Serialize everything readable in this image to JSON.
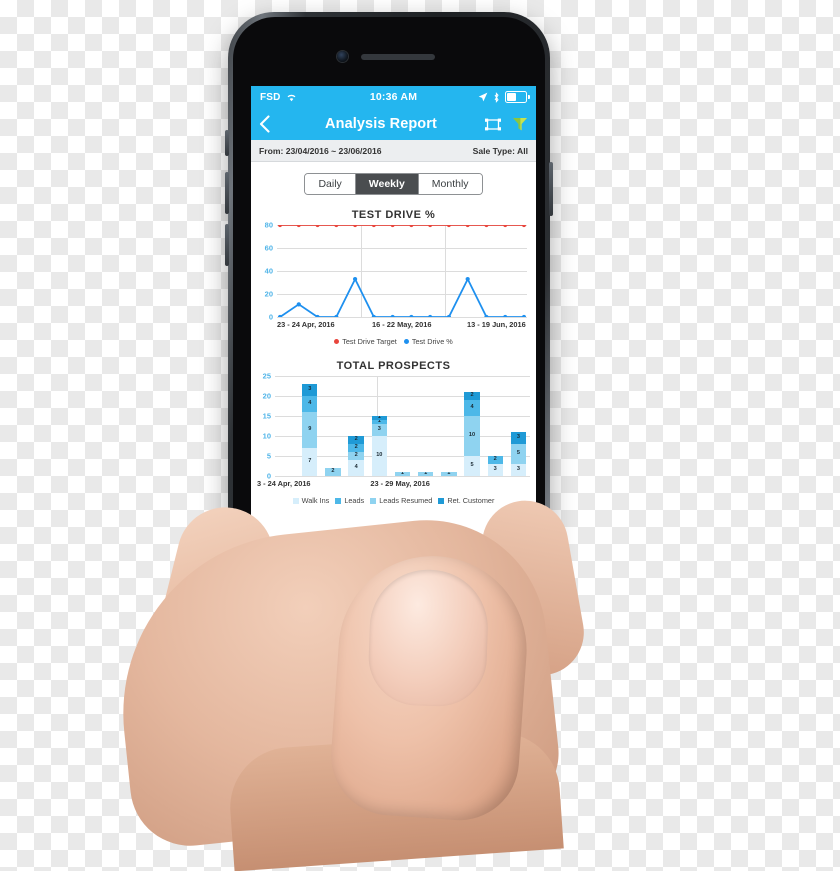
{
  "device": {
    "frame_color": "#2b2e32",
    "screen_bg": "#ffffff"
  },
  "status_bar": {
    "carrier": "FSD",
    "wifi_icon": "wifi-icon",
    "time": "10:36 AM",
    "location_icon": "location-arrow-icon",
    "bluetooth_icon": "bluetooth-icon",
    "battery_icon": "battery-icon",
    "accent": "#24b6ef"
  },
  "nav_bar": {
    "back_icon": "chevron-left-icon",
    "title": "Analysis Report",
    "fullscreen_icon": "fullscreen-icon",
    "filter_icon": "filter-funnel-icon",
    "filter_icon_color": "#8cc63f"
  },
  "filter_bar": {
    "date_range": "From: 23/04/2016 ~ 23/06/2016",
    "sale_type": "Sale Type: All"
  },
  "segmented": {
    "options": [
      {
        "label": "Daily",
        "active": false
      },
      {
        "label": "Weekly",
        "active": true
      },
      {
        "label": "Monthly",
        "active": false
      }
    ]
  },
  "chart_data": [
    {
      "type": "line",
      "title": "TEST DRIVE %",
      "xlabel": "",
      "ylabel": "",
      "ylim": [
        0,
        80
      ],
      "yticks": [
        0,
        20,
        40,
        60,
        80
      ],
      "grid": true,
      "legend_position": "bottom",
      "x_tick_labels": [
        "23 - 24 Apr, 2016",
        "16 - 22 May, 2016",
        "13 - 19 Jun, 2016"
      ],
      "series": [
        {
          "name": "Test Drive Target",
          "color": "#e8453c",
          "values": [
            80,
            80,
            80,
            80,
            80,
            80,
            80,
            80,
            80,
            80,
            80,
            80,
            80,
            80
          ]
        },
        {
          "name": "Test Drive %",
          "color": "#1e90ef",
          "values": [
            0,
            11,
            0,
            0,
            33,
            0,
            0,
            0,
            0,
            0,
            33,
            0,
            0,
            0
          ]
        }
      ]
    },
    {
      "type": "bar",
      "subtype": "stacked",
      "title": "TOTAL PROSPECTS",
      "xlabel": "",
      "ylabel": "",
      "ylim": [
        0,
        25
      ],
      "yticks": [
        0,
        5,
        10,
        15,
        20,
        25
      ],
      "grid": true,
      "legend_position": "bottom",
      "x_tick_labels": [
        "3 - 24 Apr, 2016",
        "23 - 29 May, 2016"
      ],
      "series": [
        {
          "name": "Walk Ins",
          "color": "#d6eefb"
        },
        {
          "name": "Leads",
          "color": "#4db8e8"
        },
        {
          "name": "Leads Resumed",
          "color": "#8fd3f0"
        },
        {
          "name": "Ret. Customer",
          "color": "#1f9ad6"
        }
      ],
      "bars": [
        {
          "index": 0,
          "total": 0,
          "segments": []
        },
        {
          "index": 1,
          "total": 23,
          "segments": [
            {
              "series": "Walk Ins",
              "value": 7
            },
            {
              "series": "Leads Resumed",
              "value": 9
            },
            {
              "series": "Leads",
              "value": 4
            },
            {
              "series": "Ret. Customer",
              "value": 3
            }
          ]
        },
        {
          "index": 2,
          "total": 2,
          "segments": [
            {
              "series": "Leads Resumed",
              "value": 2
            }
          ]
        },
        {
          "index": 3,
          "total": 10,
          "segments": [
            {
              "series": "Walk Ins",
              "value": 4
            },
            {
              "series": "Leads Resumed",
              "value": 2
            },
            {
              "series": "Leads",
              "value": 2
            },
            {
              "series": "Ret. Customer",
              "value": 2
            }
          ]
        },
        {
          "index": 4,
          "total": 15,
          "segments": [
            {
              "series": "Walk Ins",
              "value": 10
            },
            {
              "series": "Leads Resumed",
              "value": 3
            },
            {
              "series": "Leads",
              "value": 1
            },
            {
              "series": "Ret. Customer",
              "value": 1
            }
          ]
        },
        {
          "index": 5,
          "total": 1,
          "segments": [
            {
              "series": "Leads Resumed",
              "value": 1
            }
          ]
        },
        {
          "index": 6,
          "total": 1,
          "segments": [
            {
              "series": "Leads Resumed",
              "value": 1
            }
          ]
        },
        {
          "index": 7,
          "total": 1,
          "segments": [
            {
              "series": "Leads Resumed",
              "value": 1
            }
          ]
        },
        {
          "index": 8,
          "total": 21,
          "segments": [
            {
              "series": "Walk Ins",
              "value": 5
            },
            {
              "series": "Leads Resumed",
              "value": 10
            },
            {
              "series": "Leads",
              "value": 4
            },
            {
              "series": "Ret. Customer",
              "value": 2
            }
          ]
        },
        {
          "index": 9,
          "total": 5,
          "segments": [
            {
              "series": "Walk Ins",
              "value": 3
            },
            {
              "series": "Leads",
              "value": 2
            }
          ]
        },
        {
          "index": 10,
          "total": 11,
          "segments": [
            {
              "series": "Walk Ins",
              "value": 3
            },
            {
              "series": "Leads Resumed",
              "value": 5
            },
            {
              "series": "Ret. Customer",
              "value": 3
            }
          ]
        }
      ]
    }
  ]
}
